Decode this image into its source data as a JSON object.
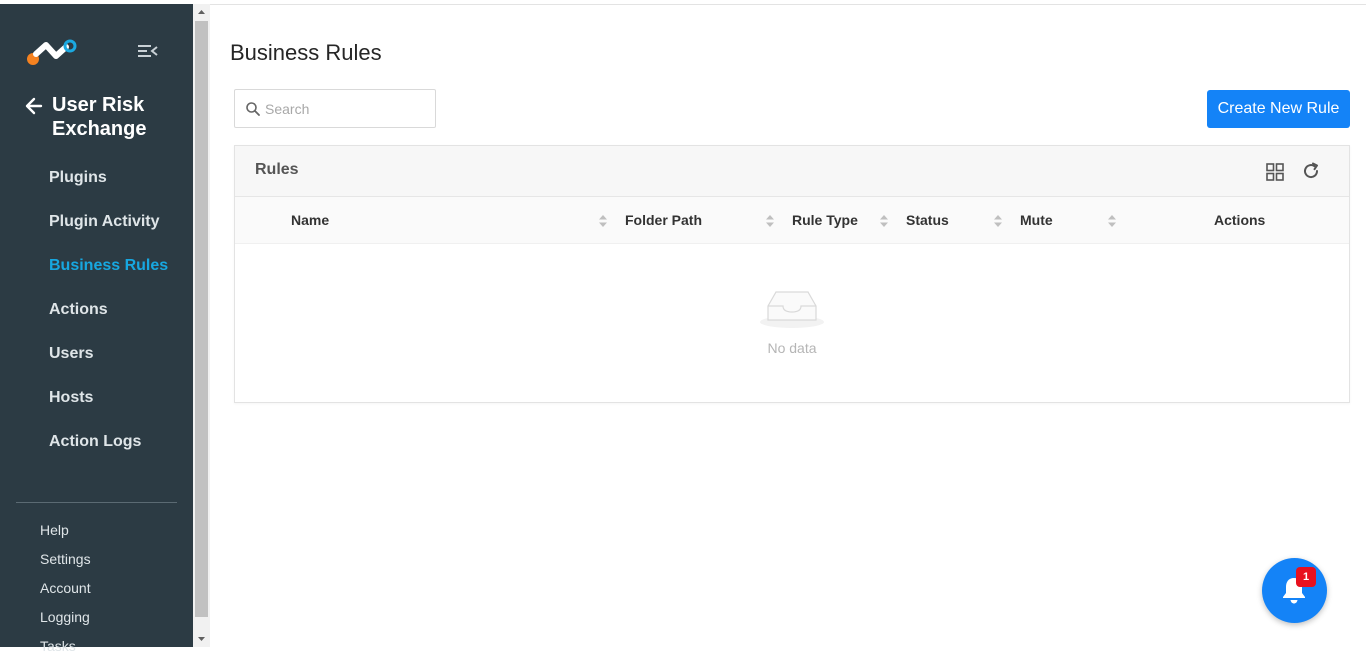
{
  "sidebar": {
    "module_title": "User Risk Exchange",
    "items": [
      {
        "label": "Plugins"
      },
      {
        "label": "Plugin Activity"
      },
      {
        "label": "Business Rules"
      },
      {
        "label": "Actions"
      },
      {
        "label": "Users"
      },
      {
        "label": "Hosts"
      },
      {
        "label": "Action Logs"
      }
    ],
    "active_item": "Business Rules",
    "bottom_items": [
      {
        "label": "Help"
      },
      {
        "label": "Settings"
      },
      {
        "label": "Account"
      },
      {
        "label": "Logging"
      },
      {
        "label": "Tasks"
      }
    ]
  },
  "page": {
    "title": "Business Rules"
  },
  "search": {
    "placeholder": "Search",
    "value": ""
  },
  "toolbar": {
    "create_label": "Create New Rule"
  },
  "card": {
    "title": "Rules"
  },
  "table": {
    "columns": [
      {
        "label": "Name"
      },
      {
        "label": "Folder Path"
      },
      {
        "label": "Rule Type"
      },
      {
        "label": "Status"
      },
      {
        "label": "Mute"
      },
      {
        "label": "Actions"
      }
    ],
    "rows": [],
    "empty_text": "No data"
  },
  "notifications": {
    "count": "1"
  },
  "colors": {
    "sidebar_bg": "#2c3b44",
    "accent": "#1483f7",
    "active_nav": "#17a7e0",
    "badge": "#e8101e"
  }
}
